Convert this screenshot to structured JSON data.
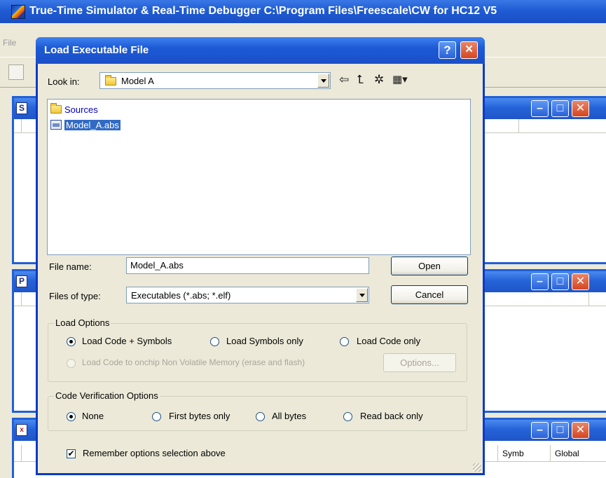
{
  "app": {
    "title": "True-Time Simulator & Real-Time Debugger   C:\\Program Files\\Freescale\\CW for HC12 V5",
    "menu_file": "File",
    "child_windows": [
      {
        "icon_letter": "S"
      },
      {
        "icon_letter": "P"
      },
      {
        "icon_letter": "x",
        "columns": [
          "Symb",
          "Global"
        ]
      }
    ]
  },
  "dialog": {
    "title": "Load Executable File",
    "help_label": "?",
    "close_label": "×",
    "look_in_label": "Look in:",
    "look_in_value": "Model A",
    "files": [
      {
        "name": "Sources",
        "type": "folder",
        "selected": false
      },
      {
        "name": "Model_A.abs",
        "type": "abs-file",
        "selected": true
      }
    ],
    "file_name_label": "File name:",
    "file_name_value": "Model_A.abs",
    "files_of_type_label": "Files of type:",
    "files_of_type_value": "Executables (*.abs; *.elf)",
    "open_label": "Open",
    "cancel_label": "Cancel",
    "load_options": {
      "title": "Load Options",
      "opt_code_symbols": "Load Code + Symbols",
      "opt_symbols_only": "Load Symbols only",
      "opt_code_only": "Load Code only",
      "opt_nonvolatile": "Load Code to onchip Non Volatile Memory (erase and flash)",
      "options_button": "Options...",
      "selected": "Load Code + Symbols"
    },
    "verification": {
      "title": "Code Verification Options",
      "opt_none": "None",
      "opt_first_bytes": "First bytes only",
      "opt_all_bytes": "All bytes",
      "opt_read_back": "Read back only",
      "selected": "None"
    },
    "remember_label": "Remember options selection above",
    "remember_checked": true
  },
  "colors": {
    "title_blue": "#1f5bd3",
    "selection_blue": "#316ac5",
    "close_red": "#d5461f",
    "dialog_face": "#ece9d8"
  }
}
